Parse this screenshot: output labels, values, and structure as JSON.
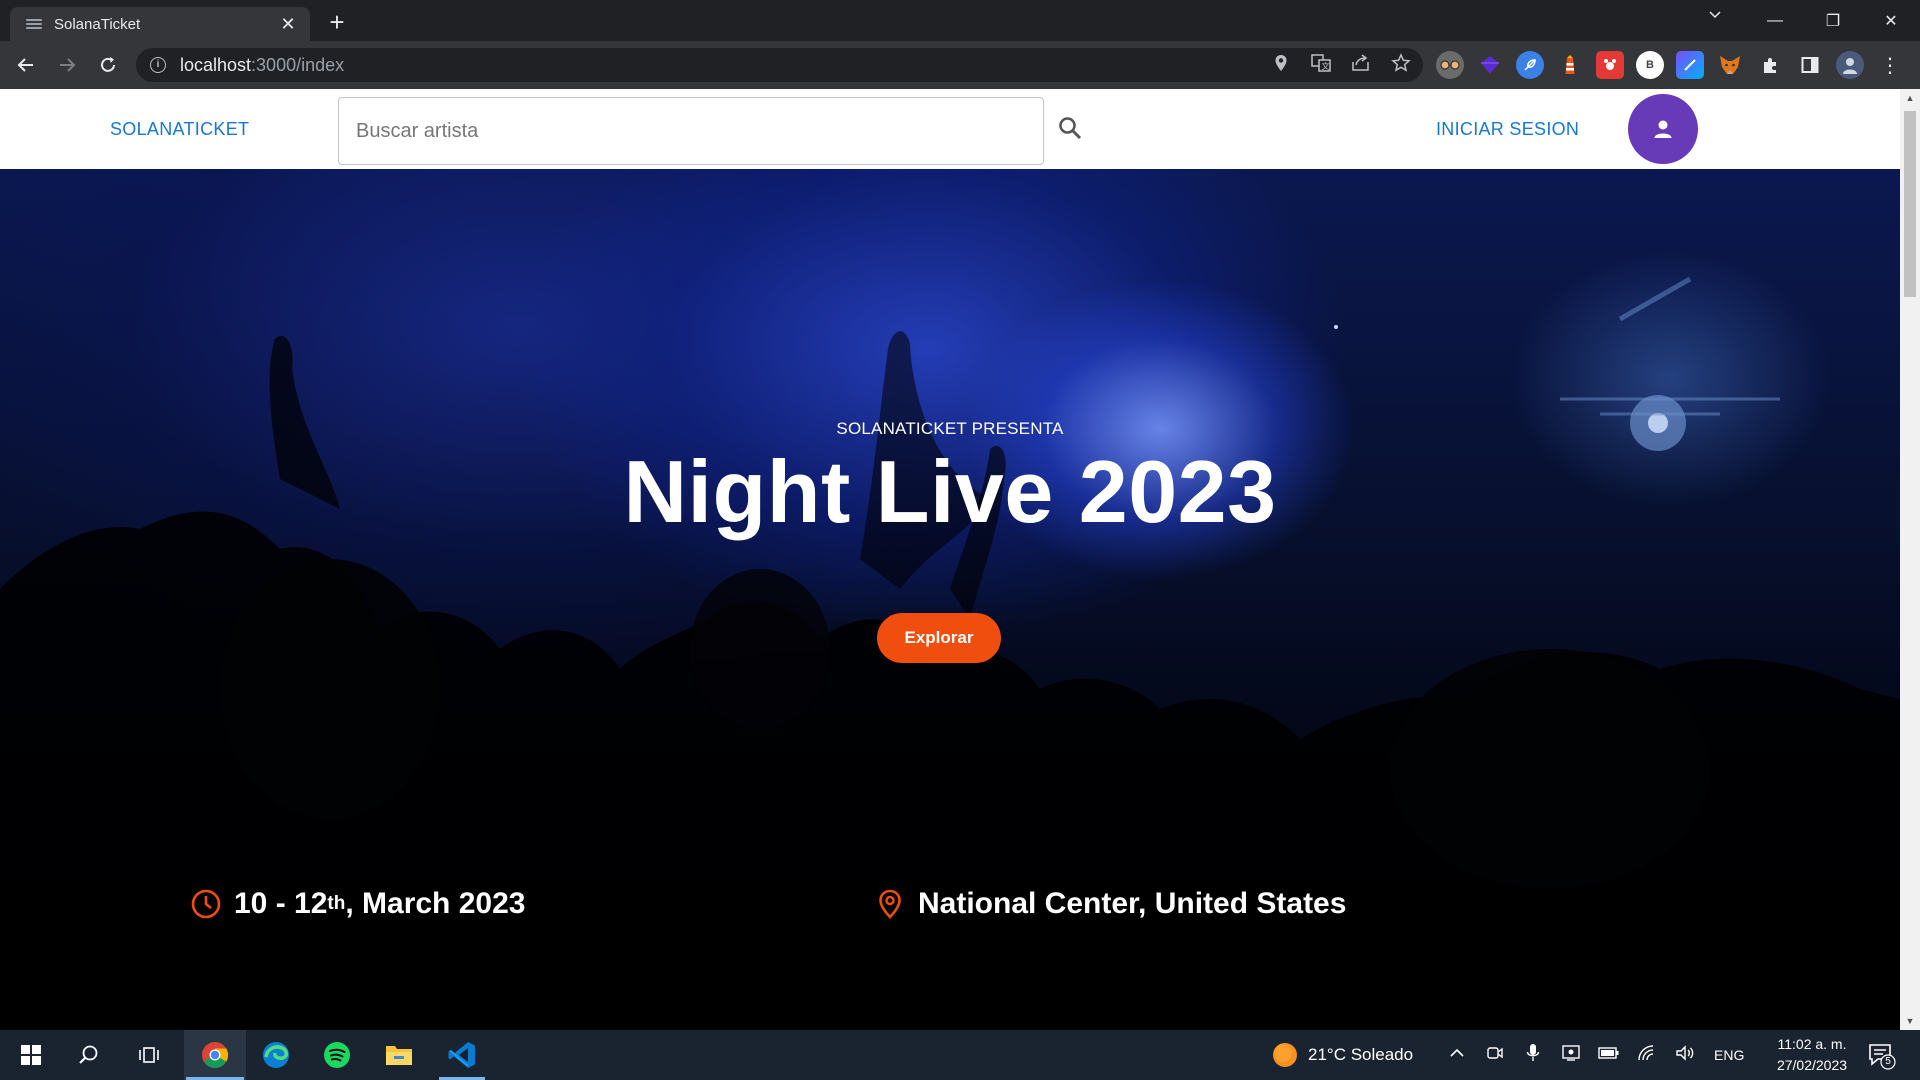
{
  "browser": {
    "tab_title": "SolanaTicket",
    "tab_close": "✕",
    "new_tab": "+",
    "url_host": "localhost",
    "url_path": ":3000/index",
    "window_controls": {
      "minimize": "—",
      "restore": "❐",
      "close": "✕"
    }
  },
  "site": {
    "brand": "SOLANATICKET",
    "search_placeholder": "Buscar artista",
    "login_label": "INICIAR SESION",
    "colors": {
      "link": "#1976d2",
      "avatar": "#673ab7",
      "accent": "#ef4e0e"
    }
  },
  "hero": {
    "presenta": "SOLANATICKET PRESENTA",
    "title": "Night Live 2023",
    "explore_label": "Explorar",
    "date_prefix": "10 - 12",
    "date_sup": "th",
    "date_suffix": ", March 2023",
    "location": "National Center, United States"
  },
  "taskbar": {
    "weather": "21°C  Soleado",
    "language": "ENG",
    "time": "11:02 a. m.",
    "date": "27/02/2023",
    "notifications": "5",
    "apps": [
      "start-icon",
      "search-icon",
      "task-view-icon",
      "chrome-icon",
      "edge-icon",
      "spotify-icon",
      "file-explorer-icon",
      "vscode-icon"
    ]
  }
}
